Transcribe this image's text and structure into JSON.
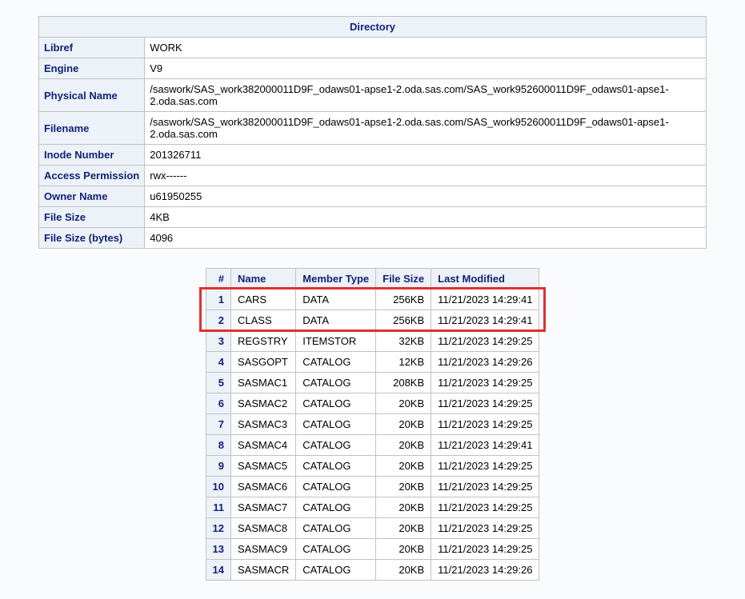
{
  "directory": {
    "title": "Directory",
    "rows": [
      {
        "label": "Libref",
        "value": "WORK"
      },
      {
        "label": "Engine",
        "value": "V9"
      },
      {
        "label": "Physical Name",
        "value": "/saswork/SAS_work382000011D9F_odaws01-apse1-2.oda.sas.com/SAS_work952600011D9F_odaws01-apse1-2.oda.sas.com"
      },
      {
        "label": "Filename",
        "value": "/saswork/SAS_work382000011D9F_odaws01-apse1-2.oda.sas.com/SAS_work952600011D9F_odaws01-apse1-2.oda.sas.com"
      },
      {
        "label": "Inode Number",
        "value": "201326711"
      },
      {
        "label": "Access Permission",
        "value": "rwx------"
      },
      {
        "label": "Owner Name",
        "value": "u61950255"
      },
      {
        "label": "File Size",
        "value": "4KB"
      },
      {
        "label": "File Size (bytes)",
        "value": "4096"
      }
    ]
  },
  "members": {
    "headers": {
      "num": "#",
      "name": "Name",
      "type": "Member Type",
      "size": "File Size",
      "modified": "Last Modified"
    },
    "rows": [
      {
        "num": "1",
        "name": "CARS",
        "type": "DATA",
        "size": "256KB",
        "modified": "11/21/2023 14:29:41",
        "highlighted": true
      },
      {
        "num": "2",
        "name": "CLASS",
        "type": "DATA",
        "size": "256KB",
        "modified": "11/21/2023 14:29:41",
        "highlighted": true
      },
      {
        "num": "3",
        "name": "REGSTRY",
        "type": "ITEMSTOR",
        "size": "32KB",
        "modified": "11/21/2023 14:29:25"
      },
      {
        "num": "4",
        "name": "SASGOPT",
        "type": "CATALOG",
        "size": "12KB",
        "modified": "11/21/2023 14:29:26"
      },
      {
        "num": "5",
        "name": "SASMAC1",
        "type": "CATALOG",
        "size": "208KB",
        "modified": "11/21/2023 14:29:25"
      },
      {
        "num": "6",
        "name": "SASMAC2",
        "type": "CATALOG",
        "size": "20KB",
        "modified": "11/21/2023 14:29:25"
      },
      {
        "num": "7",
        "name": "SASMAC3",
        "type": "CATALOG",
        "size": "20KB",
        "modified": "11/21/2023 14:29:25"
      },
      {
        "num": "8",
        "name": "SASMAC4",
        "type": "CATALOG",
        "size": "20KB",
        "modified": "11/21/2023 14:29:41"
      },
      {
        "num": "9",
        "name": "SASMAC5",
        "type": "CATALOG",
        "size": "20KB",
        "modified": "11/21/2023 14:29:25"
      },
      {
        "num": "10",
        "name": "SASMAC6",
        "type": "CATALOG",
        "size": "20KB",
        "modified": "11/21/2023 14:29:25"
      },
      {
        "num": "11",
        "name": "SASMAC7",
        "type": "CATALOG",
        "size": "20KB",
        "modified": "11/21/2023 14:29:25"
      },
      {
        "num": "12",
        "name": "SASMAC8",
        "type": "CATALOG",
        "size": "20KB",
        "modified": "11/21/2023 14:29:25"
      },
      {
        "num": "13",
        "name": "SASMAC9",
        "type": "CATALOG",
        "size": "20KB",
        "modified": "11/21/2023 14:29:25"
      },
      {
        "num": "14",
        "name": "SASMACR",
        "type": "CATALOG",
        "size": "20KB",
        "modified": "11/21/2023 14:29:26"
      }
    ]
  }
}
